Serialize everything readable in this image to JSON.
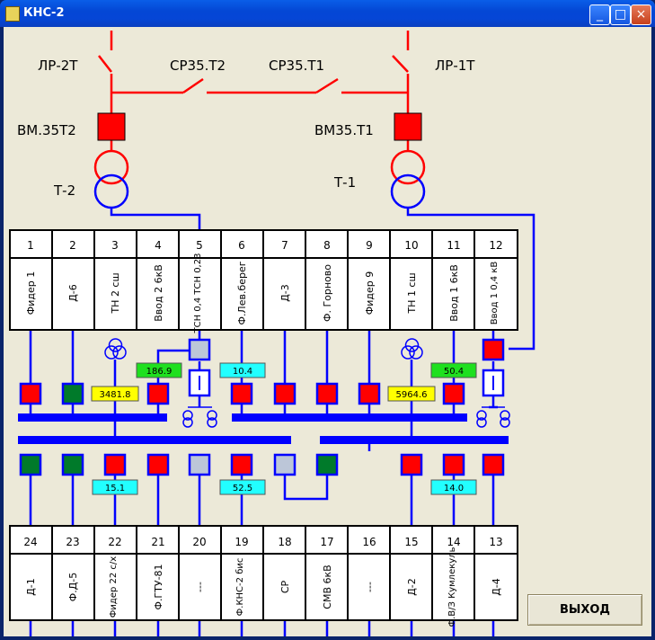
{
  "window": {
    "title": "КНС-2"
  },
  "titlebar": {
    "minimize_label": "_",
    "maximize_label": "□",
    "close_label": "×"
  },
  "schema": {
    "breakers": {
      "lr2t": "ЛР-2Т",
      "sr35t2": "СР35.Т2",
      "sr35t1": "СР35.Т1",
      "lr1t": "ЛР-1Т",
      "vm35t2": "ВМ.35Т2",
      "vm35t1": "ВМ35.Т1"
    },
    "transformers": {
      "t2": "Т-2",
      "t1": "Т-1"
    }
  },
  "top_panel": [
    {
      "num": "1",
      "label": "Фидер 1"
    },
    {
      "num": "2",
      "label": "Д-6"
    },
    {
      "num": "3",
      "label": "ТН 2 сш"
    },
    {
      "num": "4",
      "label": "Ввод 2 6кВ"
    },
    {
      "num": "5",
      "label": "ТСН 0,4 ТСН 0,23"
    },
    {
      "num": "6",
      "label": "Ф.Лев.берег"
    },
    {
      "num": "7",
      "label": "Д-3"
    },
    {
      "num": "8",
      "label": "Ф. Горново"
    },
    {
      "num": "9",
      "label": "Фидер 9"
    },
    {
      "num": "10",
      "label": "ТН 1 сш"
    },
    {
      "num": "11",
      "label": "Ввод 1 6кВ"
    },
    {
      "num": "12",
      "label": "Ввод 1 0,4 кВ"
    }
  ],
  "bottom_panel": [
    {
      "num": "24",
      "label": "Д-1"
    },
    {
      "num": "23",
      "label": "Ф.Д-5"
    },
    {
      "num": "22",
      "label": "Фидер 22 с/х"
    },
    {
      "num": "21",
      "label": "Ф.ГТУ-81"
    },
    {
      "num": "20",
      "label": "---"
    },
    {
      "num": "19",
      "label": "Ф.КНС-2 бис"
    },
    {
      "num": "18",
      "label": "СР"
    },
    {
      "num": "17",
      "label": "СМВ 6кВ"
    },
    {
      "num": "16",
      "label": "---"
    },
    {
      "num": "15",
      "label": "Д-2"
    },
    {
      "num": "14",
      "label": "Ф.В/З Кумлекуль"
    },
    {
      "num": "13",
      "label": "Д-4"
    }
  ],
  "readings": {
    "r_186_9": "186.9",
    "r_10_4": "10.4",
    "r_50_4": "50.4",
    "r_3481_8": "3481.8",
    "r_5964_6": "5964.6",
    "r_15_1": "15.1",
    "r_52_5": "52.5",
    "r_14_0": "14.0"
  },
  "colors": {
    "line_red": "#ff0000",
    "line_blue": "#0000ff",
    "state_on": "#ff0000",
    "state_off": "#007a2a",
    "state_none": "#bcc6d8",
    "green_box": "#1fe01f",
    "yellow_box": "#ffff00",
    "cyan_box": "#22ffff"
  },
  "exit_button": {
    "label": "ВЫХОД"
  }
}
